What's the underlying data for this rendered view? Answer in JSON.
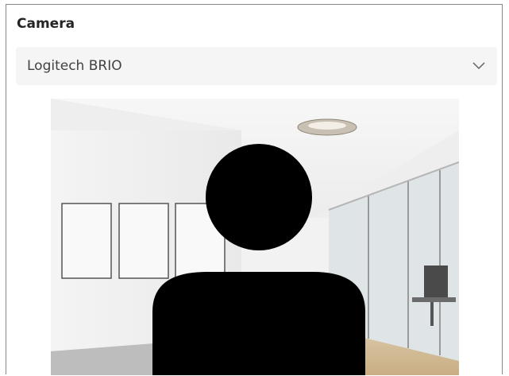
{
  "camera": {
    "title": "Camera",
    "selected_device": "Logitech BRIO"
  },
  "icons": {
    "dropdown": "chevron-down-icon",
    "avatar": "person-silhouette-icon"
  },
  "colors": {
    "panel_border": "#8a8886",
    "select_bg": "#f5f5f5",
    "text": "#242424"
  }
}
